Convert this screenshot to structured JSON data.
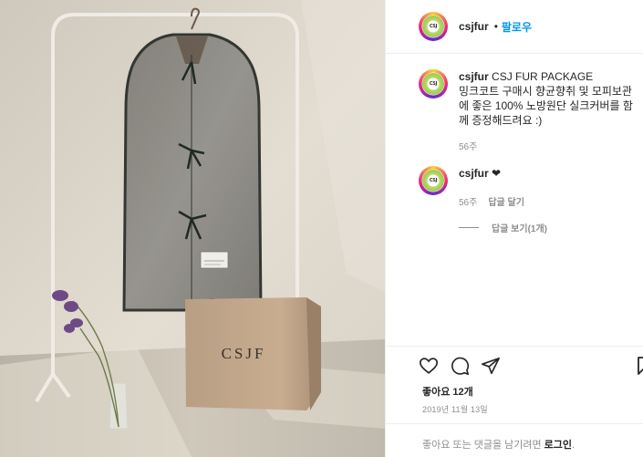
{
  "post": {
    "username": "csjfur",
    "follow_label": "팔로우",
    "dot": "•",
    "avatar_text": "CSJ"
  },
  "comments": [
    {
      "username": "csjfur",
      "text_title": "CSJ FUR PACKAGE",
      "text_body": "밍크코트 구매시 향균향취 및 모피보관에 좋은 100% 노방원단 실크커버를 함께 증정해드려요 :)",
      "age": "56주"
    },
    {
      "username": "csjfur",
      "text": "❤",
      "age": "56주",
      "reply_label": "답글 달기",
      "view_replies": "답글 보기(1개)"
    }
  ],
  "actions": {
    "likes": "좋아요 12개",
    "date": "2019년 11월 13일",
    "login_prompt": "좋아요 또는 댓글을 남기려면",
    "login_link": "로그인",
    "login_suffix": "."
  },
  "photo": {
    "bag_label": "CSJF",
    "tag_label": "CSJF"
  }
}
